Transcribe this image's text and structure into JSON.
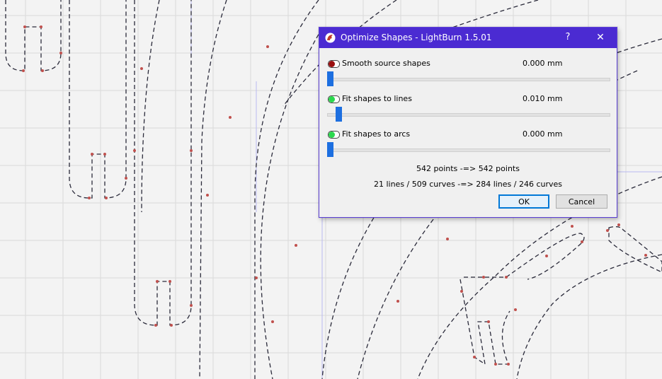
{
  "dialog": {
    "title": "Optimize Shapes - LightBurn 1.5.01",
    "help_label": "?",
    "close_label": "✕",
    "options": [
      {
        "label": "Smooth source shapes",
        "value": "0.000 mm",
        "enabled": false,
        "slider": 0.0
      },
      {
        "label": "Fit shapes to lines",
        "value": "0.010 mm",
        "enabled": true,
        "slider": 0.03
      },
      {
        "label": "Fit shapes to arcs",
        "value": "0.000 mm",
        "enabled": true,
        "slider": 0.0
      }
    ],
    "points_summary": "542 points  -=>  542 points",
    "curves_summary": "21 lines / 509 curves -=> 284 lines / 246 curves",
    "ok_label": "OK",
    "cancel_label": "Cancel"
  },
  "colors": {
    "titlebar": "#4b2bd2",
    "toggle_on": "#2bd84d",
    "toggle_off": "#9a0f0f",
    "slider_thumb": "#1d6fe0",
    "grid": "#d6d6d6",
    "shape_path": "#2a2a3a",
    "node": "#c0504d"
  }
}
